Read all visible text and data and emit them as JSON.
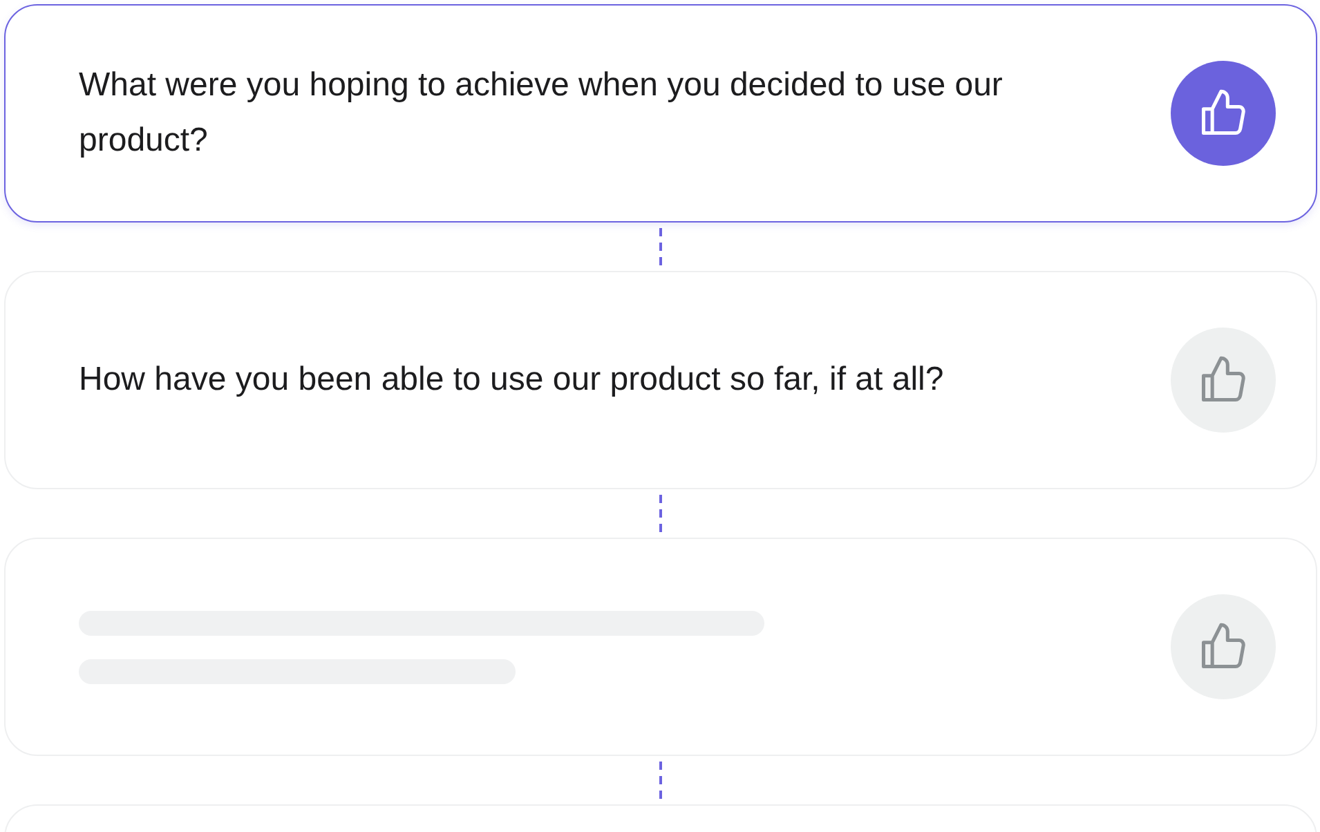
{
  "cards": [
    {
      "kind": "question",
      "text": "What were you hoping to achieve when you decided to use our product?",
      "selected": true
    },
    {
      "kind": "question",
      "text": "How have you been able to use our product so far, if at all?",
      "selected": false
    },
    {
      "kind": "placeholder",
      "selected": false
    },
    {
      "kind": "partial"
    }
  ]
}
